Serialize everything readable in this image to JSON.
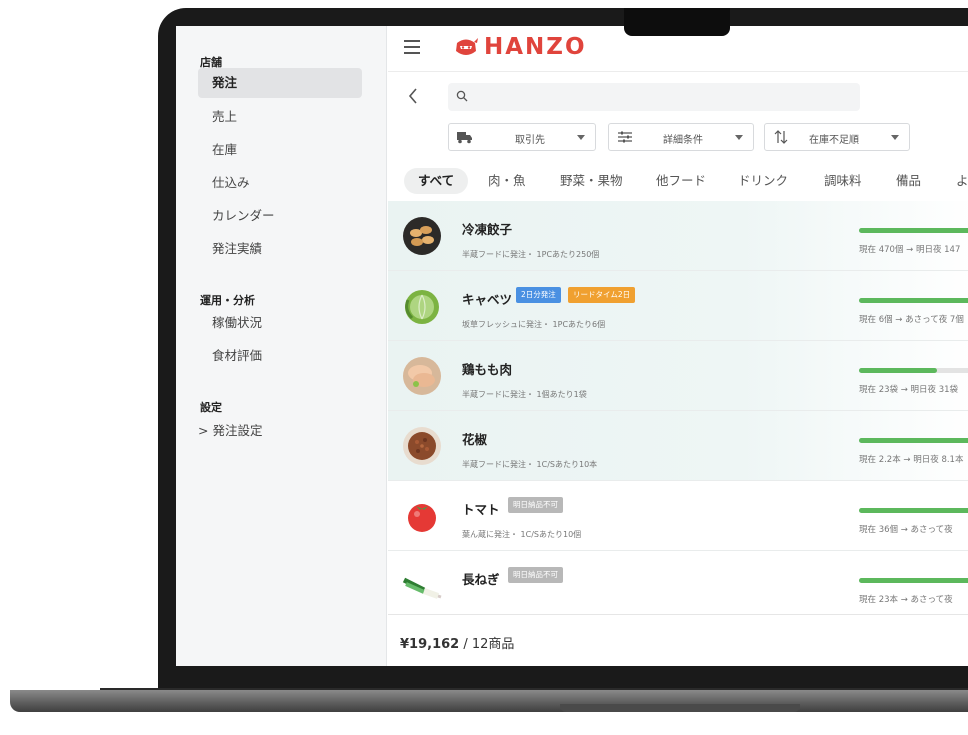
{
  "sidebar": {
    "sections": [
      {
        "title": "店舗"
      },
      {
        "title": "運用・分析"
      },
      {
        "title": "設定"
      }
    ],
    "items": [
      {
        "label": "発注"
      },
      {
        "label": "売上"
      },
      {
        "label": "在庫"
      },
      {
        "label": "仕込み"
      },
      {
        "label": "カレンダー"
      },
      {
        "label": "発注実績"
      },
      {
        "label": "稼働状況"
      },
      {
        "label": "食材評価"
      },
      {
        "label": "> 発注設定"
      }
    ]
  },
  "header": {
    "brand": "HANZO",
    "brand_color": "#e0443c"
  },
  "search": {
    "placeholder": ""
  },
  "filters": [
    {
      "label": "取引先",
      "icon": "truck-icon"
    },
    {
      "label": "詳細条件",
      "icon": "sliders-icon"
    },
    {
      "label": "在庫不足順",
      "icon": "sort-icon"
    }
  ],
  "tabs": [
    {
      "label": "すべて"
    },
    {
      "label": "肉・魚"
    },
    {
      "label": "野菜・果物"
    },
    {
      "label": "他フード"
    },
    {
      "label": "ドリンク"
    },
    {
      "label": "調味料"
    },
    {
      "label": "備品"
    },
    {
      "label": "よ"
    }
  ],
  "products": [
    {
      "name": "冷凍餃子",
      "sub": "半蔵フードに発注・ 1PCあたり250個",
      "stock": "現在 470個 → 明日夜 147",
      "level": 1.0,
      "badges": []
    },
    {
      "name": "キャベツ",
      "sub": "坂草フレッシュに発注・ 1PCあたり6個",
      "stock": "現在 6個 → あさって夜 7個",
      "level": 1.0,
      "badges": [
        {
          "label": "2日分発注",
          "color": "#4a90e2"
        },
        {
          "label": "リードタイム2日",
          "color": "#f0a030"
        }
      ]
    },
    {
      "name": "鶏もも肉",
      "sub": "半蔵フードに発注・ 1個あたり1袋",
      "stock": "現在 23袋 → 明日夜 31袋",
      "level": 0.6,
      "badges": []
    },
    {
      "name": "花椒",
      "sub": "半蔵フードに発注・ 1C/Sあたり10本",
      "stock": "現在 2.2本 → 明日夜 8.1本",
      "level": 1.0,
      "badges": []
    },
    {
      "name": "トマト",
      "sub": "葉ん蔵に発注・ 1C/Sあたり10個",
      "stock": "現在 36個 → あさって夜",
      "level": 1.0,
      "badges": [
        {
          "label": "明日納品不可",
          "color": "#b8b8b8"
        }
      ]
    },
    {
      "name": "長ねぎ",
      "sub": "",
      "stock": "現在 23本 → あさって夜",
      "level": 1.0,
      "badges": [
        {
          "label": "明日納品不可",
          "color": "#b8b8b8"
        }
      ]
    }
  ],
  "footer": {
    "total": "¥19,162",
    "count": " / 12商品"
  },
  "accent_green": "#5cb85c"
}
